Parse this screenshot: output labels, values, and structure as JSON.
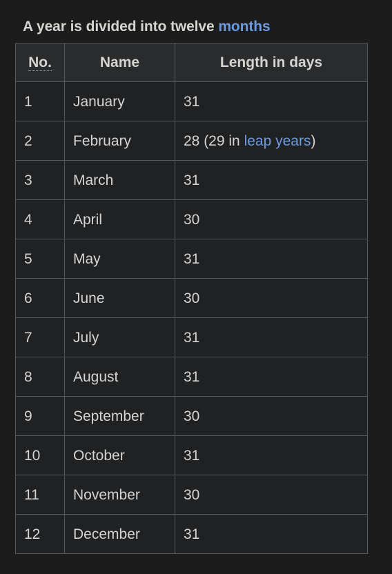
{
  "page": {
    "background_color": "#1c1c1c",
    "text_color": "#d6d4d0",
    "link_color": "#6b9ae0",
    "border_color": "#54595d"
  },
  "title": {
    "before": "A year is divided into twelve ",
    "link": "months"
  },
  "table": {
    "headers": {
      "no": "No.",
      "name": "Name",
      "length": "Length in days"
    },
    "rows": [
      {
        "no": "1",
        "name": "January",
        "length_prefix": "31",
        "length_link": "",
        "length_suffix": ""
      },
      {
        "no": "2",
        "name": "February",
        "length_prefix": "28 (29 in ",
        "length_link": "leap years",
        "length_suffix": ")"
      },
      {
        "no": "3",
        "name": "March",
        "length_prefix": "31",
        "length_link": "",
        "length_suffix": ""
      },
      {
        "no": "4",
        "name": "April",
        "length_prefix": "30",
        "length_link": "",
        "length_suffix": ""
      },
      {
        "no": "5",
        "name": "May",
        "length_prefix": "31",
        "length_link": "",
        "length_suffix": ""
      },
      {
        "no": "6",
        "name": "June",
        "length_prefix": "30",
        "length_link": "",
        "length_suffix": ""
      },
      {
        "no": "7",
        "name": "July",
        "length_prefix": "31",
        "length_link": "",
        "length_suffix": ""
      },
      {
        "no": "8",
        "name": "August",
        "length_prefix": "31",
        "length_link": "",
        "length_suffix": ""
      },
      {
        "no": "9",
        "name": "September",
        "length_prefix": "30",
        "length_link": "",
        "length_suffix": ""
      },
      {
        "no": "10",
        "name": "October",
        "length_prefix": "31",
        "length_link": "",
        "length_suffix": ""
      },
      {
        "no": "11",
        "name": "November",
        "length_prefix": "30",
        "length_link": "",
        "length_suffix": ""
      },
      {
        "no": "12",
        "name": "December",
        "length_prefix": "31",
        "length_link": "",
        "length_suffix": ""
      }
    ]
  }
}
